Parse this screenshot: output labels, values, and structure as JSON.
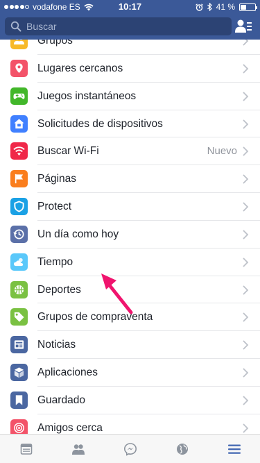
{
  "status": {
    "carrier": "vodafone ES",
    "time": "10:17",
    "battery": "41 %",
    "battery_level": 0.41
  },
  "search": {
    "placeholder": "Buscar"
  },
  "menu": [
    {
      "label": "Grupos",
      "icon": "groups-icon",
      "color": "#f7b928"
    },
    {
      "label": "Lugares cercanos",
      "icon": "location-pin-icon",
      "color": "#f35369"
    },
    {
      "label": "Juegos instantáneos",
      "icon": "gamepad-icon",
      "color": "#42b72a"
    },
    {
      "label": "Solicitudes de dispositivos",
      "icon": "device-home-icon",
      "color": "#4080ff"
    },
    {
      "label": "Buscar Wi-Fi",
      "icon": "wifi-icon",
      "color": "#f02849",
      "badge": "Nuevo"
    },
    {
      "label": "Páginas",
      "icon": "flag-icon",
      "color": "#fa7e1e"
    },
    {
      "label": "Protect",
      "icon": "shield-icon",
      "color": "#1aa1e5"
    },
    {
      "label": "Un día como hoy",
      "icon": "history-clock-icon",
      "color": "#5b70a8"
    },
    {
      "label": "Tiempo",
      "icon": "cloud-sun-icon",
      "color": "#5ac8fa"
    },
    {
      "label": "Deportes",
      "icon": "sports-ball-icon",
      "color": "#7ac142"
    },
    {
      "label": "Grupos de compraventa",
      "icon": "price-tag-icon",
      "color": "#7ac142"
    },
    {
      "label": "Noticias",
      "icon": "news-feed-icon",
      "color": "#4b67a1"
    },
    {
      "label": "Aplicaciones",
      "icon": "cube-icon",
      "color": "#4b67a1"
    },
    {
      "label": "Guardado",
      "icon": "bookmark-icon",
      "color": "#4b67a1"
    },
    {
      "label": "Amigos cerca",
      "icon": "radar-icon",
      "color": "#f35369"
    }
  ],
  "tabs": [
    {
      "icon": "news-feed-tab-icon",
      "active": false
    },
    {
      "icon": "friends-tab-icon",
      "active": false
    },
    {
      "icon": "messenger-tab-icon",
      "active": false
    },
    {
      "icon": "globe-tab-icon",
      "active": false
    },
    {
      "icon": "menu-tab-icon",
      "active": true
    }
  ],
  "colors": {
    "brand": "#3b5998",
    "annotation_arrow": "#f0146e"
  }
}
